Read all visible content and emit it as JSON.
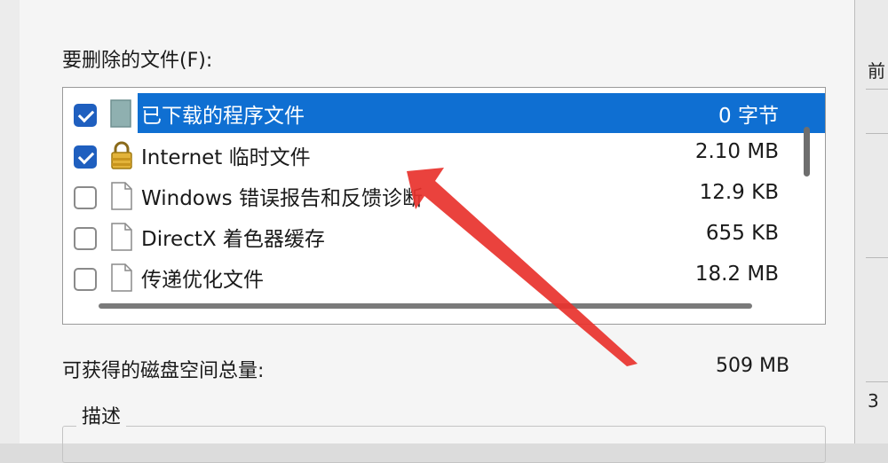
{
  "dialog": {
    "files_label": "要删除的文件(F):",
    "space_label": "可获得的磁盘空间总量:",
    "space_value": "509 MB",
    "group_label": "描述"
  },
  "files": [
    {
      "name": "已下载的程序文件",
      "size": "0 字节",
      "checked": true,
      "selected": true,
      "icon": "folder-icon"
    },
    {
      "name": "Internet 临时文件",
      "size": "2.10 MB",
      "checked": true,
      "selected": false,
      "icon": "lock-icon"
    },
    {
      "name": "Windows 错误报告和反馈诊断",
      "size": "12.9 KB",
      "checked": false,
      "selected": false,
      "icon": "file-icon"
    },
    {
      "name": "DirectX 着色器缓存",
      "size": "655 KB",
      "checked": false,
      "selected": false,
      "icon": "file-icon"
    },
    {
      "name": "传递优化文件",
      "size": "18.2 MB",
      "checked": false,
      "selected": false,
      "icon": "file-icon"
    }
  ],
  "right_peek": {
    "top": "前",
    "bottom": "3"
  },
  "colors": {
    "selection": "#0f6fd2",
    "checkbox": "#1f5fbf",
    "arrow": "#e8322d"
  }
}
